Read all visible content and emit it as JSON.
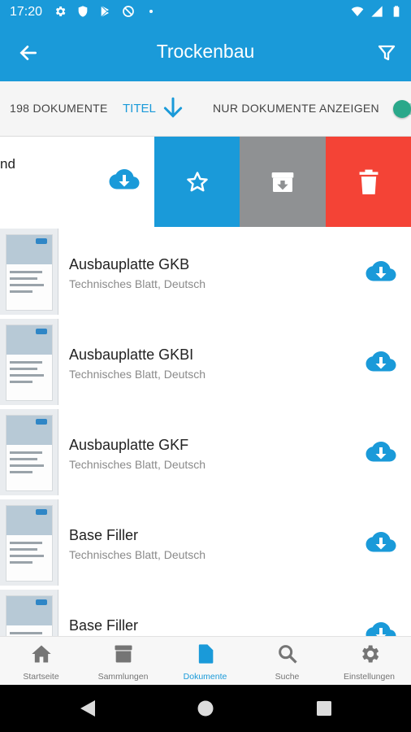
{
  "status_bar": {
    "time": "17:20"
  },
  "app_bar": {
    "title": "Trockenbau"
  },
  "sort_bar": {
    "doc_count": "198 DOKUMENTE",
    "sort_label": "TITEL",
    "only_docs_label": "NUR DOKUMENTE ANZEIGEN",
    "only_docs_enabled": true
  },
  "swiped_item": {
    "partial_text": "nd",
    "actions": [
      "star-icon",
      "archive-icon",
      "delete-icon"
    ]
  },
  "documents": [
    {
      "title": "Ausbauplatte GKB",
      "subtitle": "Technisches Blatt, Deutsch"
    },
    {
      "title": "Ausbauplatte GKBI",
      "subtitle": "Technisches Blatt, Deutsch"
    },
    {
      "title": "Ausbauplatte GKF",
      "subtitle": "Technisches Blatt, Deutsch"
    },
    {
      "title": "Base Filler",
      "subtitle": "Technisches Blatt, Deutsch"
    },
    {
      "title": "Base Filler",
      "subtitle": ""
    }
  ],
  "bottom_nav": [
    {
      "label": "Startseite",
      "icon": "home-icon",
      "active": false
    },
    {
      "label": "Sammlungen",
      "icon": "collections-icon",
      "active": false
    },
    {
      "label": "Dokumente",
      "icon": "document-icon",
      "active": true
    },
    {
      "label": "Suche",
      "icon": "search-icon",
      "active": false
    },
    {
      "label": "Einstellungen",
      "icon": "settings-icon",
      "active": false
    }
  ],
  "colors": {
    "primary": "#1a9ad9",
    "archive": "#8f9193",
    "delete": "#f44336",
    "toggle": "#2aa88a"
  }
}
